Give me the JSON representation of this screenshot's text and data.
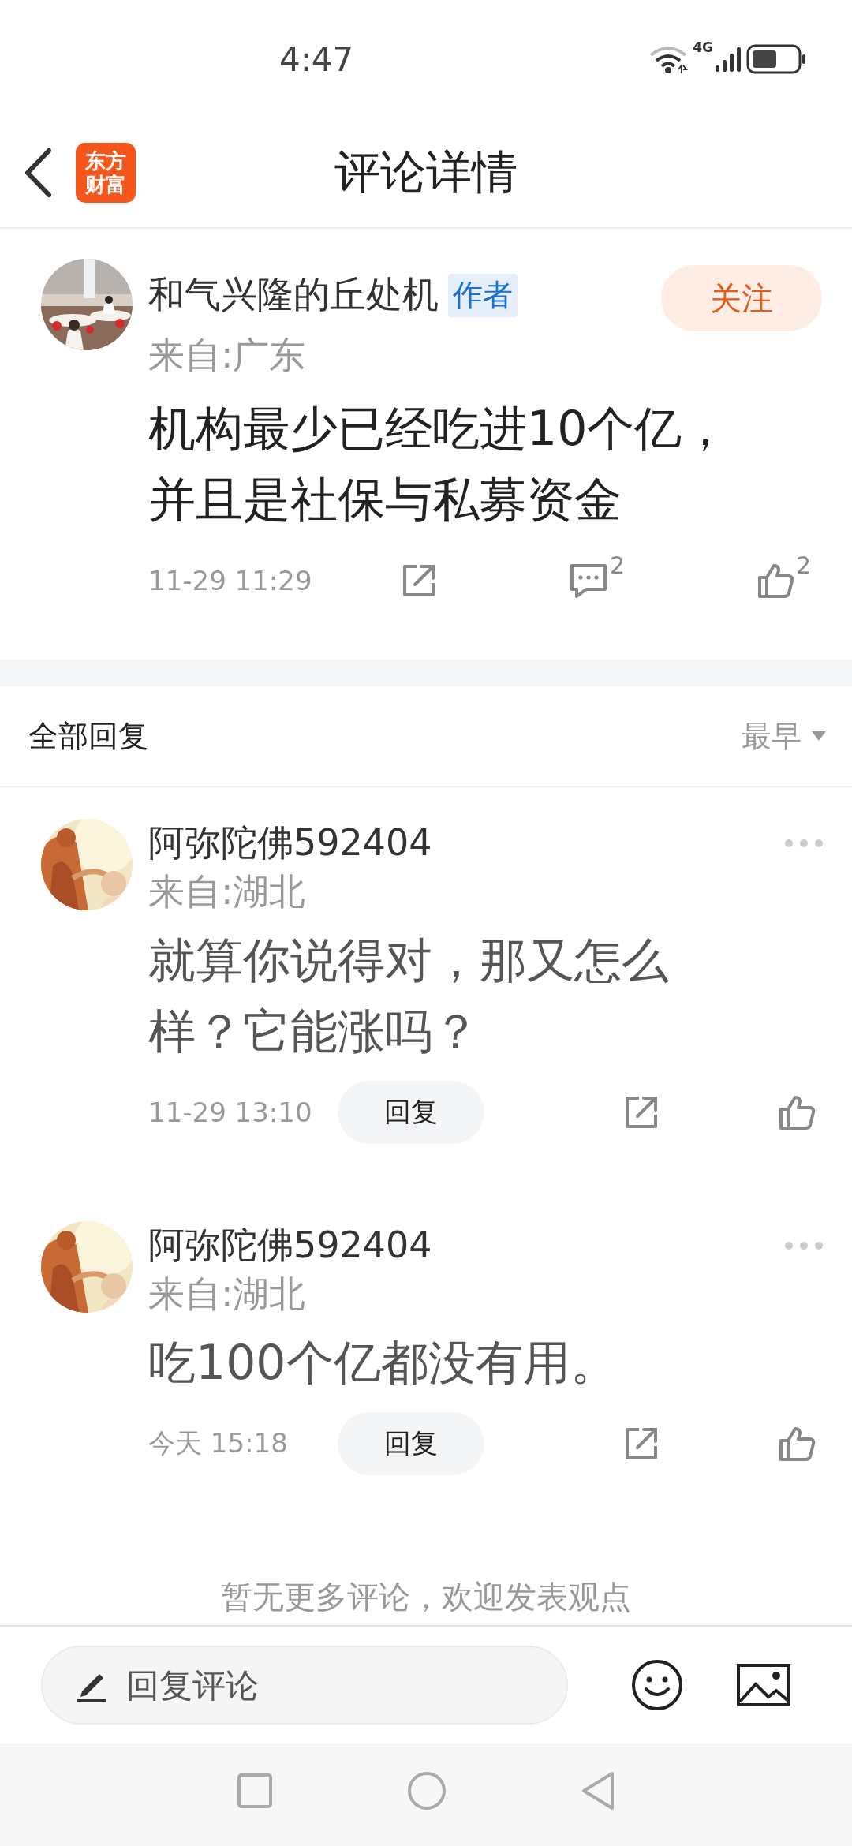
{
  "status_bar": {
    "time": "4:47",
    "network": "4G"
  },
  "header": {
    "title": "评论详情",
    "logo": [
      "东方",
      "财富"
    ]
  },
  "post": {
    "author": "和气兴隆的丘处机",
    "badge": "作者",
    "follow": "关注",
    "location": "来自:广东",
    "text": "机构最少已经吃进10个亿，并且是社保与私募资金",
    "time": "11-29 11:29",
    "comment_count": "2",
    "like_count": "2"
  },
  "replies_header": {
    "title": "全部回复",
    "sort": "最早"
  },
  "replies": [
    {
      "author": "阿弥陀佛592404",
      "location": "来自:湖北",
      "text": "就算你说得对，那又怎么样？它能涨吗？",
      "time": "11-29 13:10",
      "reply": "回复"
    },
    {
      "author": "阿弥陀佛592404",
      "location": "来自:湖北",
      "text": "吃100个亿都没有用。",
      "time": "今天 15:18",
      "reply": "回复"
    }
  ],
  "end_note": "暂无更多评论，欢迎发表观点",
  "composer": {
    "placeholder": "回复评论"
  }
}
